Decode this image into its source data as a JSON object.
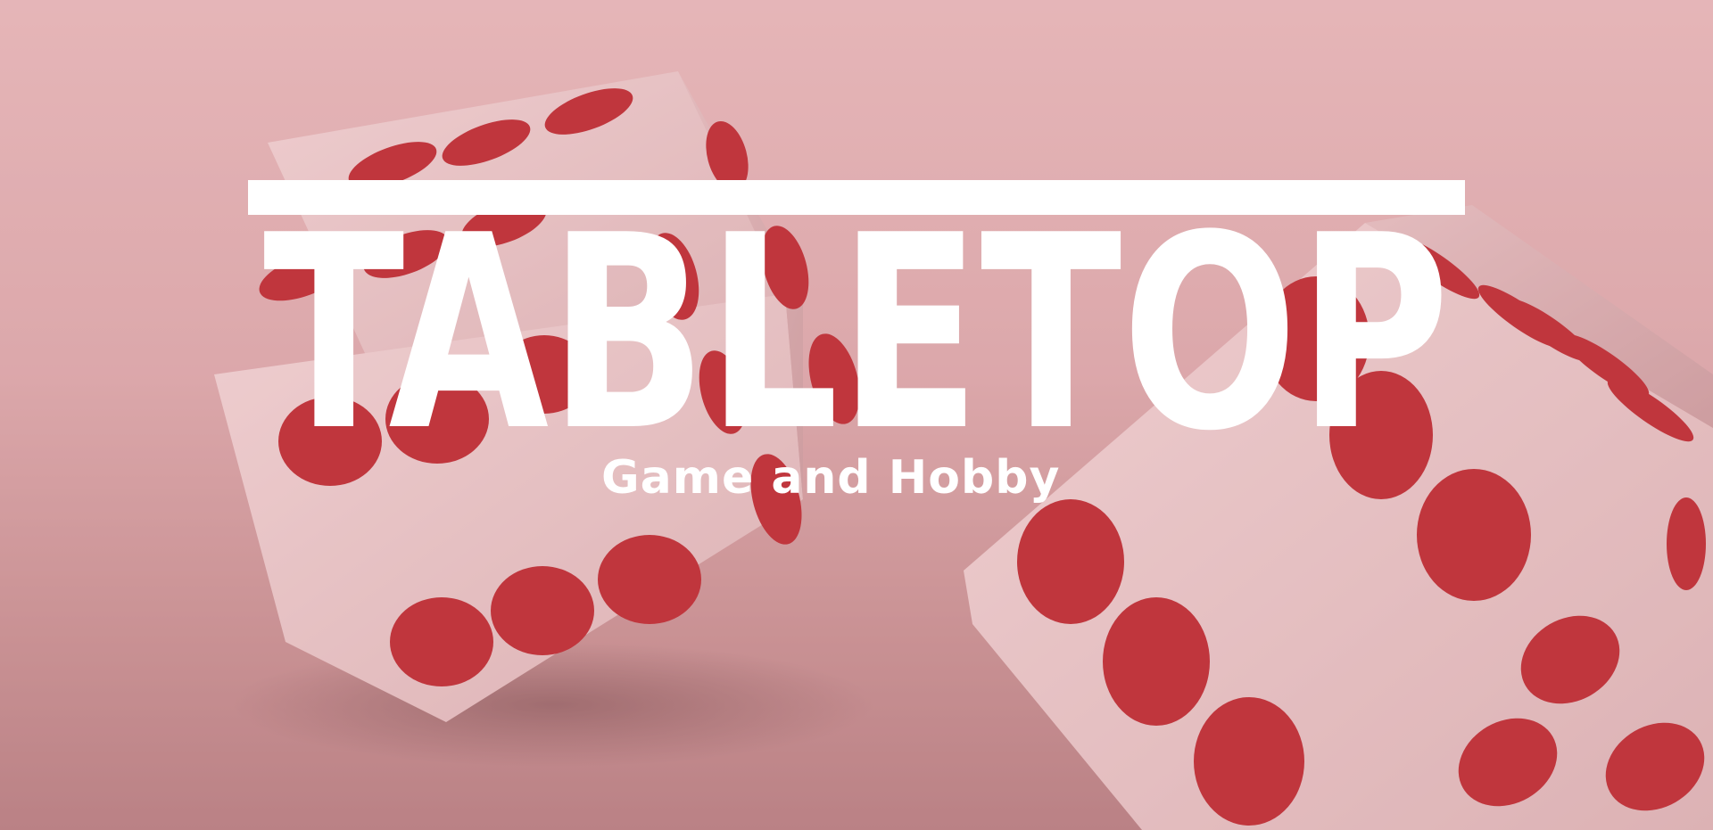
{
  "brand": {
    "name": "TABLETOP",
    "tagline": "Game and Hobby"
  },
  "colors": {
    "background_light": "#e6b7b9",
    "background_dark": "#a86c70",
    "die_face": "#efd2d3",
    "pip": "#b0000a",
    "logo": "#ffffff"
  },
  "icons": {
    "left_die": "die-icon",
    "right_die": "die-icon"
  }
}
